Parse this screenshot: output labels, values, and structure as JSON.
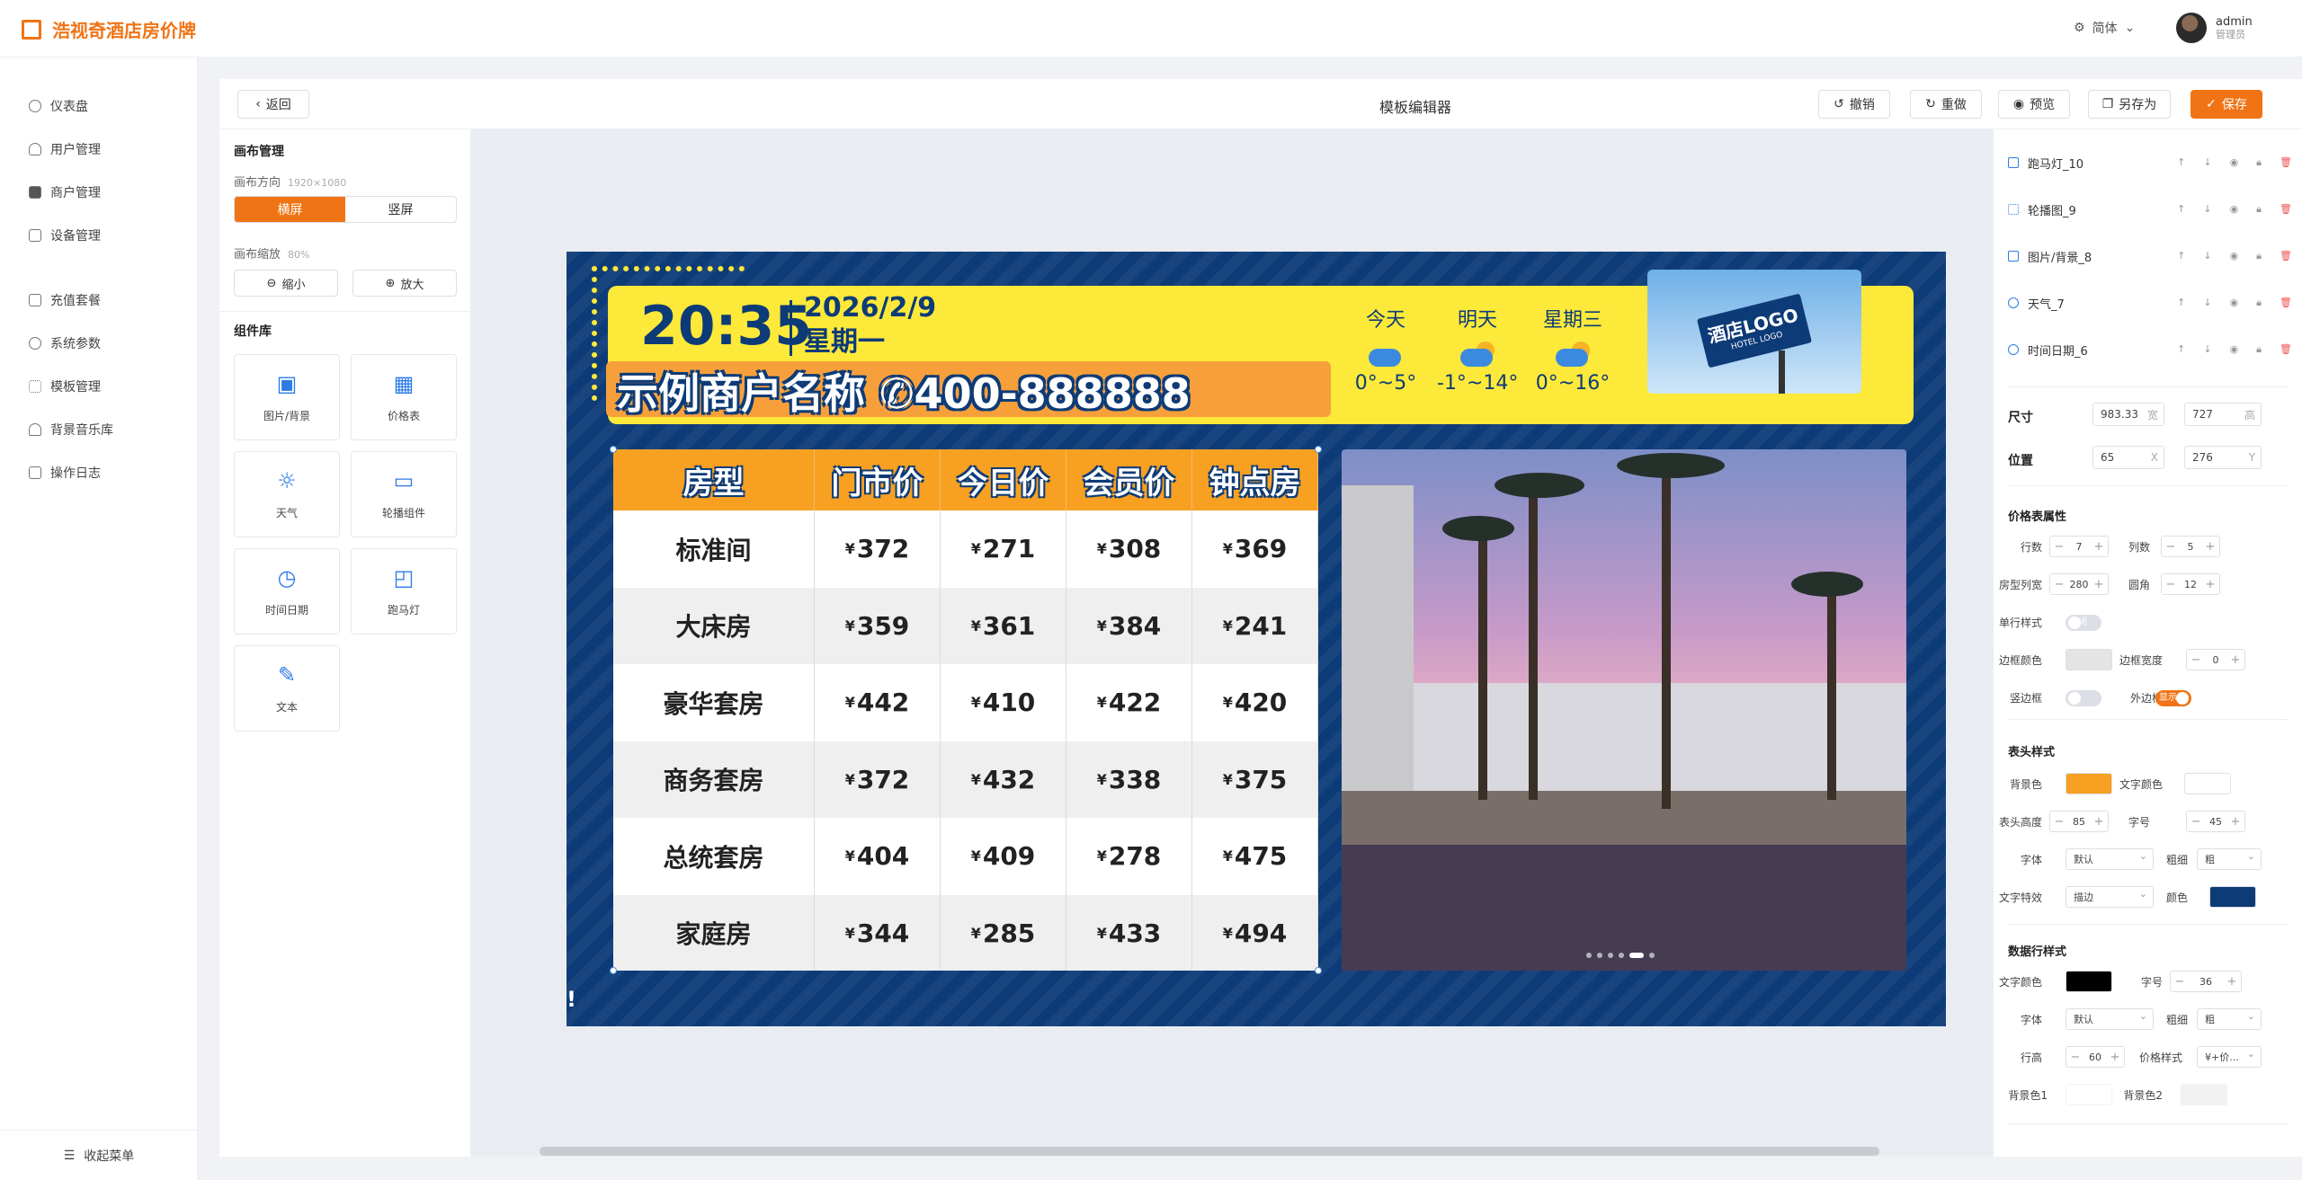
{
  "app": {
    "title": "浩视奇酒店房价牌"
  },
  "header": {
    "lang": "简体",
    "user": "admin",
    "role": "管理员"
  },
  "sidebar": {
    "items": [
      {
        "label": "仪表盘"
      },
      {
        "label": "用户管理"
      },
      {
        "label": "商户管理"
      },
      {
        "label": "设备管理"
      },
      {
        "label": "充值套餐"
      },
      {
        "label": "系统参数"
      },
      {
        "label": "模板管理"
      },
      {
        "label": "背景音乐库"
      },
      {
        "label": "操作日志"
      }
    ],
    "collapse": "收起菜单"
  },
  "toolbar": {
    "back": "返回",
    "title": "模板编辑器",
    "undo": "撤销",
    "redo": "重做",
    "preview": "预览",
    "save_as": "另存为",
    "save": "保存"
  },
  "left": {
    "canvas_title": "画布管理",
    "orient_label": "画布方向",
    "resolution": "1920×1080",
    "landscape": "横屏",
    "portrait": "竖屏",
    "zoom_label": "画布缩放",
    "zoom": "80%",
    "zoom_out": "缩小",
    "zoom_in": "放大",
    "lib_title": "组件库",
    "components": [
      {
        "label": "图片/背景",
        "icon": "image-icon"
      },
      {
        "label": "价格表",
        "icon": "grid-icon"
      },
      {
        "label": "天气",
        "icon": "sun-icon"
      },
      {
        "label": "轮播组件",
        "icon": "carousel-icon"
      },
      {
        "label": "时间日期",
        "icon": "clock-icon"
      },
      {
        "label": "跑马灯",
        "icon": "marquee-icon"
      },
      {
        "label": "文本",
        "icon": "edit-icon"
      }
    ]
  },
  "board": {
    "time": "20:35",
    "date": "2026/2/9",
    "weekday": "星期一",
    "merchant": "示例商户名称 ✆400-888888",
    "weather": [
      {
        "day": "今天",
        "temp": "0°~5°"
      },
      {
        "day": "明天",
        "temp": "-1°~14°"
      },
      {
        "day": "星期三",
        "temp": "0°~16°"
      }
    ],
    "logo": {
      "text": "酒店LOGO",
      "sub": "HOTEL LOGO"
    },
    "marquee": "!",
    "table": {
      "headers": [
        "房型",
        "门市价",
        "今日价",
        "会员价",
        "钟点房"
      ],
      "currency": "¥",
      "rows": [
        [
          "标准间",
          "372",
          "271",
          "308",
          "369"
        ],
        [
          "大床房",
          "359",
          "361",
          "384",
          "241"
        ],
        [
          "豪华套房",
          "442",
          "410",
          "422",
          "420"
        ],
        [
          "商务套房",
          "372",
          "432",
          "338",
          "375"
        ],
        [
          "总统套房",
          "404",
          "409",
          "278",
          "475"
        ],
        [
          "家庭房",
          "344",
          "285",
          "433",
          "494"
        ]
      ]
    }
  },
  "right": {
    "layers": [
      {
        "name": "跑马灯_10"
      },
      {
        "name": "轮播图_9"
      },
      {
        "name": "图片/背景_8"
      },
      {
        "name": "天气_7"
      },
      {
        "name": "时间日期_6"
      }
    ],
    "size_label": "尺寸",
    "width": "983.33",
    "w_unit": "宽",
    "height": "727",
    "h_unit": "高",
    "pos_label": "位置",
    "x": "65",
    "x_unit": "X",
    "y": "276",
    "y_unit": "Y",
    "price_title": "价格表属性",
    "rows_label": "行数",
    "rows": "7",
    "cols_label": "列数",
    "cols": "5",
    "typecol_label": "房型列宽",
    "typecol": "280",
    "radius_label": "圆角",
    "radius": "12",
    "single_label": "单行样式",
    "single_state": "关闭",
    "bordercolor_label": "边框颜色",
    "borderwidth_label": "边框宽度",
    "borderwidth": "0",
    "vline_label": "竖边框",
    "vline_state": "",
    "outer_label": "外边框",
    "outer_state": "显示",
    "head_title": "表头样式",
    "head_bg_label": "背景色",
    "head_text_label": "文字颜色",
    "head_h_label": "表头高度",
    "head_h": "85",
    "head_fs_label": "字号",
    "head_fs": "45",
    "font_label": "字体",
    "font": "默认",
    "weight_label": "粗细",
    "weight": "粗",
    "effect_label": "文字特效",
    "effect": "描边",
    "effect_color_label": "颜色",
    "data_title": "数据行样式",
    "data_text_label": "文字颜色",
    "data_fs_label": "字号",
    "data_fs": "36",
    "data_font_label": "字体",
    "data_font": "默认",
    "data_weight_label": "粗细",
    "data_weight": "粗",
    "lineh_label": "行高",
    "lineh": "60",
    "priceformat_label": "价格样式",
    "priceformat": "¥+价...",
    "bg1_label": "背景色1",
    "bg2_label": "背景色2",
    "colors": {
      "head_bg": "#f7a021",
      "head_text": "#ffffff",
      "effect": "#0d3b77",
      "data_text": "#000000"
    }
  }
}
